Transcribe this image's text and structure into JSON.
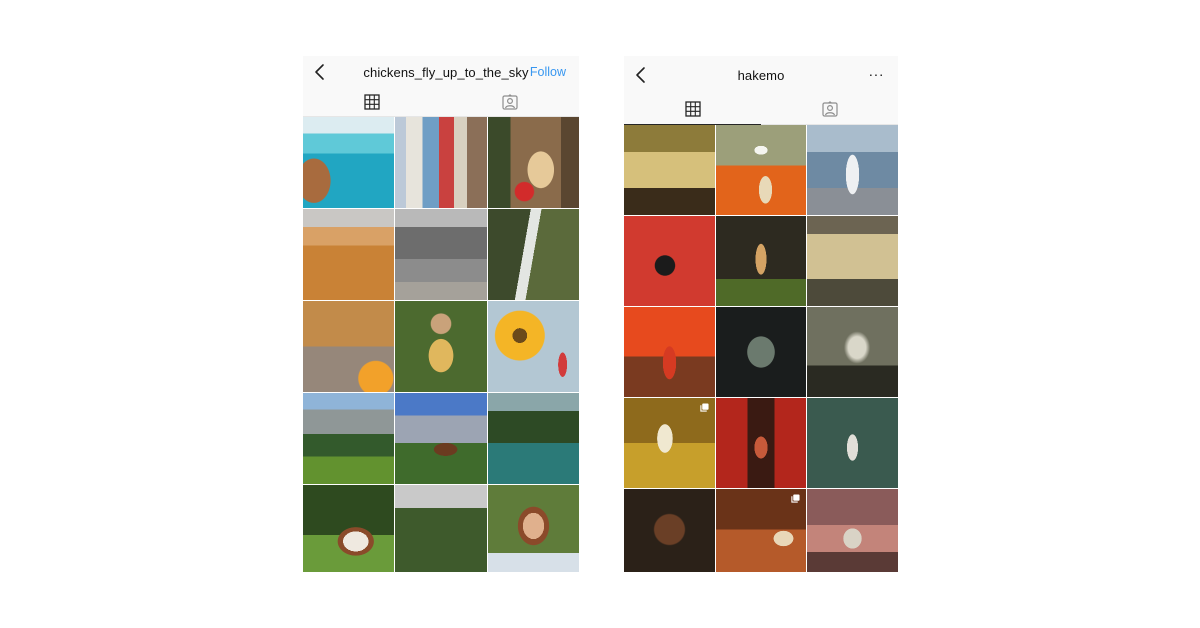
{
  "left_profile": {
    "username": "chickens_fly_up_to_the_sky",
    "follow_label": "Follow",
    "accent_color": "#3897f0",
    "icons": {
      "back": "chevron-left-icon",
      "grid_tab": "grid-icon",
      "tagged_tab": "tagged-person-icon"
    },
    "posts": [
      "coastal-cliff-swimmers",
      "colorful-alley-houses",
      "stone-archway-flowers",
      "autumn-hillside-hiker",
      "grey-mountain-peaks",
      "forest-waterfall-couple",
      "woman-walking-road",
      "woman-sun-hat-field",
      "woman-sunflowers",
      "alpine-meadow-cows",
      "mountain-chalet",
      "turquoise-lake-forest",
      "cow-lying-grass",
      "forest-mountain-view",
      "woman-sunglasses-forest"
    ]
  },
  "right_profile": {
    "username": "hakemo",
    "more_label": "···",
    "icons": {
      "back": "chevron-left-icon",
      "more": "more-dots-icon",
      "grid_tab": "grid-icon",
      "tagged_tab": "tagged-person-icon"
    },
    "posts": [
      "lighthouse-golden-sky",
      "astronaut-orange-dunes",
      "astronaut-snowy-lake",
      "astronaut-red-cloud",
      "astronaut-dark-forest",
      "misty-sepia-mountains",
      "astronaut-red-sea",
      "tree-through-window",
      "smoking-island",
      "floating-astronaut",
      "astronaut-red-train",
      "astronaut-green-room",
      "astronaut-dark-portal",
      "astronaut-cockpit",
      "astronaut-desert-dunes"
    ],
    "multi_posts": [
      9,
      13
    ]
  }
}
